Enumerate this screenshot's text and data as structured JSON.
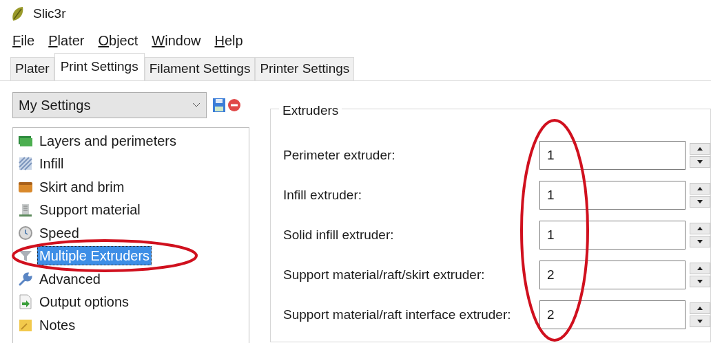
{
  "window": {
    "title": "Slic3r"
  },
  "menu": [
    {
      "label": "File",
      "mnemonic": true
    },
    {
      "label": "Plater",
      "mnemonic": true
    },
    {
      "label": "Object",
      "mnemonic": true
    },
    {
      "label": "Window",
      "mnemonic": true
    },
    {
      "label": "Help",
      "mnemonic": true
    }
  ],
  "tabs": [
    {
      "label": "Plater",
      "selected": false
    },
    {
      "label": "Print Settings",
      "selected": true
    },
    {
      "label": "Filament Settings",
      "selected": false
    },
    {
      "label": "Printer Settings",
      "selected": false
    }
  ],
  "preset": {
    "value": "My Settings"
  },
  "sections": [
    {
      "label": "Layers and perimeters",
      "kind": "layers",
      "selected": false
    },
    {
      "label": "Infill",
      "kind": "infill",
      "selected": false
    },
    {
      "label": "Skirt and brim",
      "kind": "skirt",
      "selected": false
    },
    {
      "label": "Support material",
      "kind": "support",
      "selected": false
    },
    {
      "label": "Speed",
      "kind": "speed",
      "selected": false
    },
    {
      "label": "Multiple Extruders",
      "kind": "extruders",
      "selected": true
    },
    {
      "label": "Advanced",
      "kind": "advanced",
      "selected": false
    },
    {
      "label": "Output options",
      "kind": "output",
      "selected": false
    },
    {
      "label": "Notes",
      "kind": "notes",
      "selected": false
    }
  ],
  "group": {
    "title": "Extruders",
    "fields": [
      {
        "label": "Perimeter extruder:",
        "value": "1"
      },
      {
        "label": "Infill extruder:",
        "value": "1"
      },
      {
        "label": "Solid infill extruder:",
        "value": "1"
      },
      {
        "label": "Support material/raft/skirt extruder:",
        "value": "2"
      },
      {
        "label": "Support material/raft interface extruder:",
        "value": "2"
      }
    ]
  }
}
